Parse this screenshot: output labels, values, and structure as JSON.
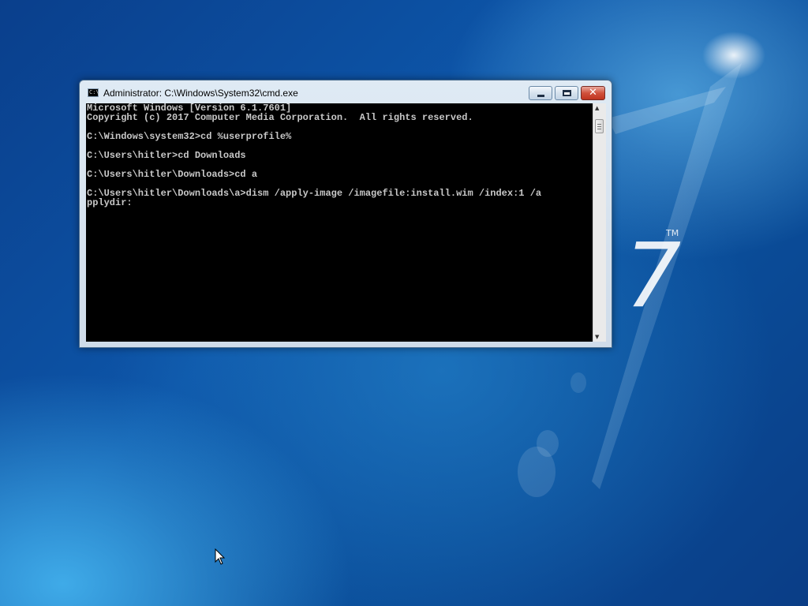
{
  "desktop": {
    "logo_text": "7",
    "trademark": "TM"
  },
  "window": {
    "title": "Administrator: C:\\Windows\\System32\\cmd.exe",
    "icon_text": "C:\\",
    "minimize_icon": "minimize-icon",
    "maximize_icon": "maximize-icon",
    "close_icon": "close-icon",
    "close_glyph": "✕"
  },
  "console": {
    "lines": "Microsoft Windows [Version 6.1.7601]\nCopyright (c) 2017 Computer Media Corporation.  All rights reserved.\n\nC:\\Windows\\system32>cd %userprofile%\n\nC:\\Users\\hitler>cd Downloads\n\nC:\\Users\\hitler\\Downloads>cd a\n\nC:\\Users\\hitler\\Downloads\\a>dism /apply-image /imagefile:install.wim /index:1 /a\npplydir:"
  },
  "scrollbar": {
    "up_glyph": "▲",
    "down_glyph": "▼"
  },
  "colors": {
    "console_bg": "#000000",
    "console_text": "#c8c8c8",
    "desktop_blue": "#0d55a8"
  }
}
